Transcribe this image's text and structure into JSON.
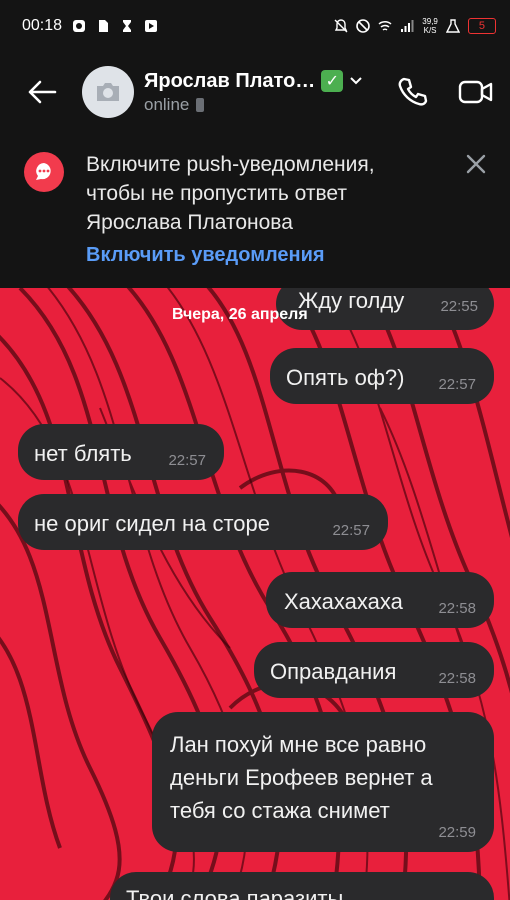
{
  "status_bar": {
    "time": "00:18",
    "net_speed_value": "39,9",
    "net_speed_unit": "K/S",
    "battery": "5"
  },
  "header": {
    "contact_name": "Ярослав Плато…",
    "status": "online"
  },
  "banner": {
    "message": "Включите push-уведомления, чтобы не пропустить ответ Ярослава Платонова",
    "link": "Включить уведомления"
  },
  "chat": {
    "date_label": "Вчера, 26 апреля",
    "messages": [
      {
        "text": "Жду голду",
        "time": "22:55",
        "side": "out"
      },
      {
        "text": "Опять оф?)",
        "time": "22:57",
        "side": "out"
      },
      {
        "text": "нет блять",
        "time": "22:57",
        "side": "in"
      },
      {
        "text": "не ориг сидел на сторе",
        "time": "22:57",
        "side": "in"
      },
      {
        "text": "Хахахахаха",
        "time": "22:58",
        "side": "out"
      },
      {
        "text": "Оправдания",
        "time": "22:58",
        "side": "out"
      },
      {
        "line1": "Лан похуй мне все равно",
        "line2": "деньги Ерофеев вернет а",
        "line3": "тебя со стажа снимет",
        "time": "22:59",
        "side": "out"
      },
      {
        "text": "Твои слова паразиты",
        "side": "out"
      }
    ]
  },
  "colors": {
    "chat_background": "#e8203c",
    "bubble": "#2a2a2c",
    "link": "#5a9cf7",
    "verified_badge": "#4caf50"
  }
}
